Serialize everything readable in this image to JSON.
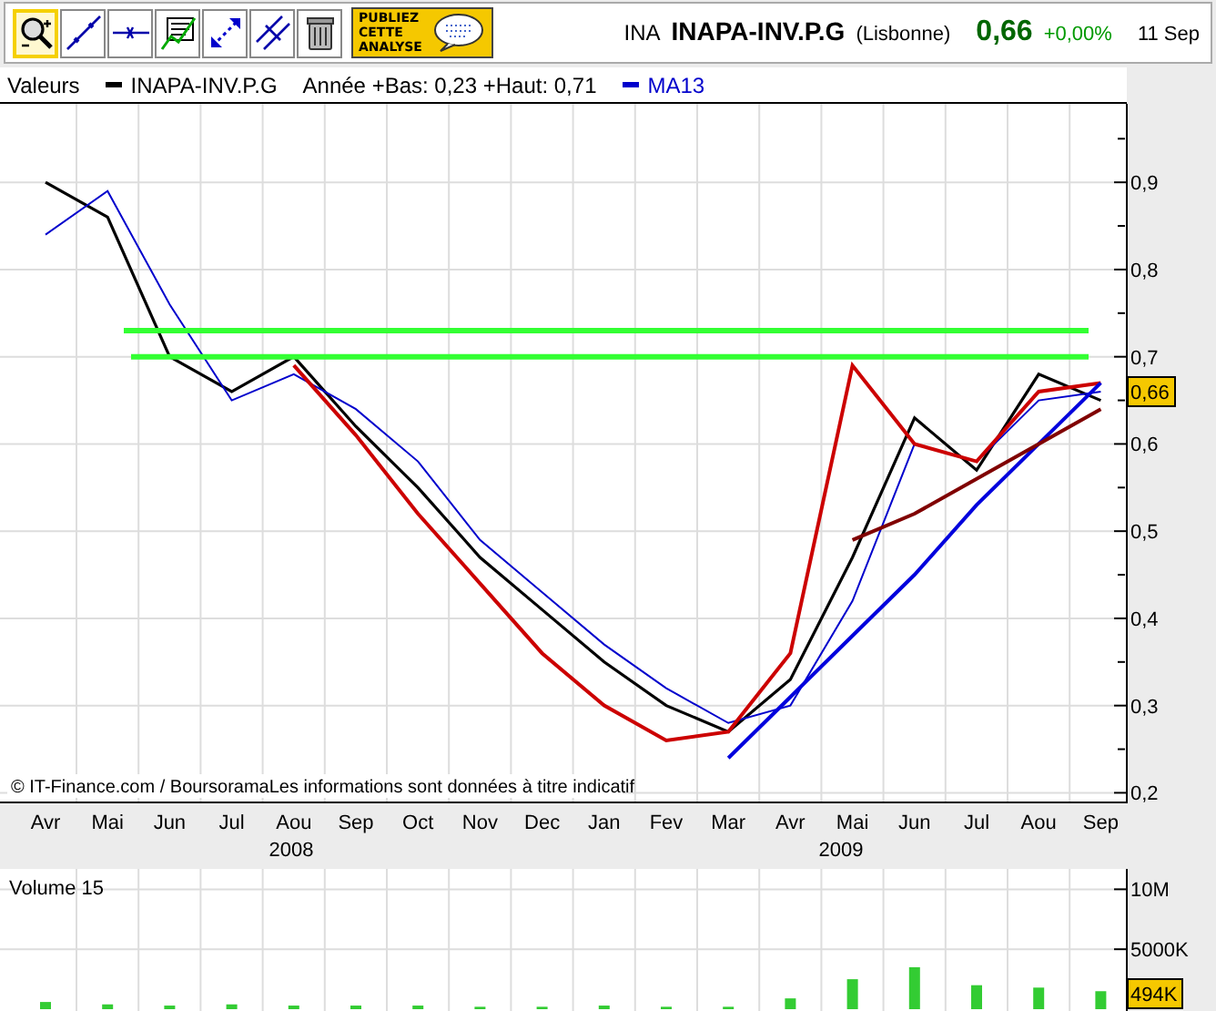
{
  "toolbar": {
    "tools": [
      {
        "kind": "zoom",
        "selected": true
      },
      {
        "kind": "line",
        "selected": false
      },
      {
        "kind": "hline",
        "selected": false
      },
      {
        "kind": "chart",
        "selected": false
      },
      {
        "kind": "arrows",
        "selected": false
      },
      {
        "kind": "parallel",
        "selected": false
      },
      {
        "kind": "trash",
        "selected": false
      }
    ],
    "publish_button": {
      "lines": [
        "PUBLIEZ",
        "CETTE",
        "ANALYSE"
      ]
    }
  },
  "quote": {
    "code": "INA",
    "name": "INAPA-INV.P.G",
    "market": "(Lisbonne)",
    "price": "0,66",
    "change": "+0,00%",
    "date": "11 Sep"
  },
  "main_chart": {
    "legend_title": "Valeurs",
    "range_text": "Année +Bas: 0,23 +Haut: 0,71",
    "last_value": "0,66",
    "copyright": "© IT-Finance.com / BoursoramaLes informations sont données à titre indicatif",
    "year_labels": [
      "2008",
      "2009"
    ],
    "chart_data": {
      "type": "line",
      "categories": [
        "Avr",
        "Mai",
        "Jun",
        "Jul",
        "Aou",
        "Sep",
        "Oct",
        "Nov",
        "Dec",
        "Jan",
        "Fev",
        "Mar",
        "Avr",
        "Mai",
        "Jun",
        "Jul",
        "Aou",
        "Sep"
      ],
      "series": [
        {
          "name": "INAPA-INV.P.G",
          "color": "#000000",
          "values": [
            0.9,
            0.86,
            0.7,
            0.66,
            0.7,
            0.62,
            0.55,
            0.47,
            0.41,
            0.35,
            0.3,
            0.27,
            0.33,
            0.47,
            0.63,
            0.57,
            0.68,
            0.65
          ]
        },
        {
          "name": "MA13",
          "color": "#0000cc",
          "values": [
            0.84,
            0.89,
            0.76,
            0.65,
            0.68,
            0.64,
            0.58,
            0.49,
            0.43,
            0.37,
            0.32,
            0.28,
            0.3,
            0.42,
            0.6,
            0.58,
            0.65,
            0.66
          ]
        },
        {
          "color": "#cc0000",
          "values": [
            null,
            null,
            null,
            null,
            0.69,
            0.61,
            0.52,
            0.44,
            0.36,
            0.3,
            0.26,
            0.27,
            0.36,
            0.69,
            0.6,
            0.58,
            0.66,
            0.67
          ]
        },
        {
          "color": "#0000dd",
          "values": [
            null,
            null,
            null,
            null,
            null,
            null,
            null,
            null,
            null,
            null,
            null,
            0.24,
            0.31,
            0.38,
            0.45,
            0.53,
            0.6,
            0.67
          ]
        },
        {
          "color": "#800000",
          "values": [
            null,
            null,
            null,
            null,
            null,
            null,
            null,
            null,
            null,
            null,
            null,
            null,
            null,
            0.49,
            0.52,
            0.56,
            0.6,
            0.64
          ]
        }
      ],
      "ref_lines": [
        {
          "axis": "y",
          "value": 0.73,
          "color": "#33ff33"
        },
        {
          "axis": "y",
          "value": 0.7,
          "color": "#33ff33"
        }
      ],
      "ylim": [
        0.19,
        0.99
      ],
      "yticks": [
        {
          "value": 0.2,
          "label": "0,2"
        },
        {
          "value": 0.3,
          "label": "0,3"
        },
        {
          "value": 0.4,
          "label": "0,4"
        },
        {
          "value": 0.5,
          "label": "0,5"
        },
        {
          "value": 0.6,
          "label": "0,6"
        },
        {
          "value": 0.7,
          "label": "0,7"
        },
        {
          "value": 0.8,
          "label": "0,8"
        },
        {
          "value": 0.9,
          "label": "0,9"
        }
      ],
      "grid": true
    }
  },
  "volume_chart": {
    "last_value": "494K",
    "chart_data": {
      "type": "bar",
      "series": [
        {
          "name": "Volume 15",
          "color": "#33cc33",
          "values": [
            600000,
            400000,
            300000,
            400000,
            300000,
            300000,
            300000,
            200000,
            200000,
            300000,
            200000,
            200000,
            900000,
            2500000,
            3500000,
            2000000,
            1800000,
            1500000
          ]
        }
      ],
      "ylim": [
        0,
        11700000
      ],
      "yticks": [
        {
          "value": 5000000,
          "label": "5000K"
        },
        {
          "value": 10000000,
          "label": "10M"
        }
      ],
      "grid": true
    }
  }
}
